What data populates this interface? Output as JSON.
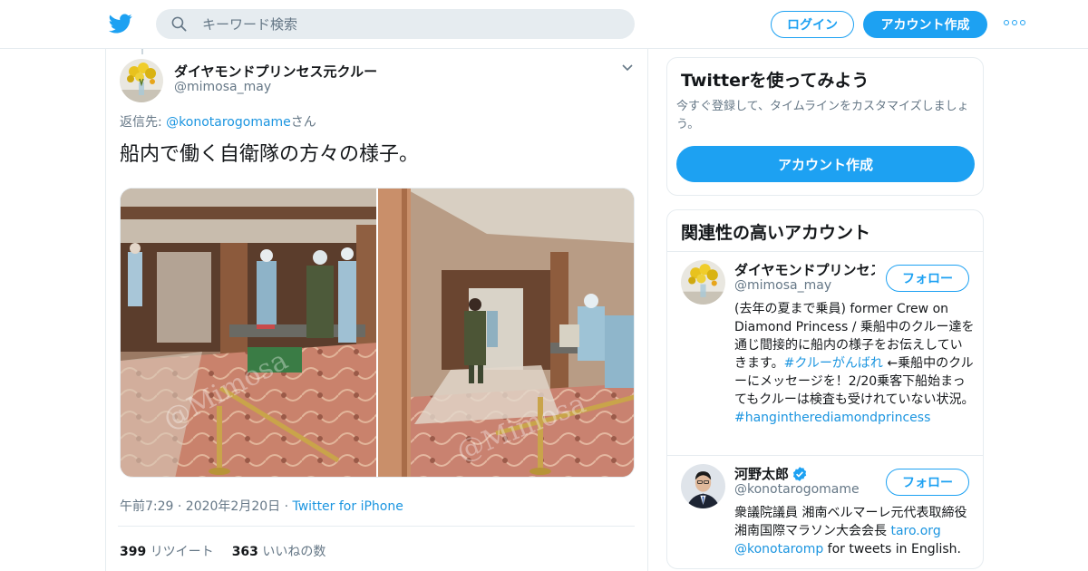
{
  "header": {
    "logo_icon": "twitter-bird-icon",
    "search_placeholder": "キーワード検索",
    "login_label": "ログイン",
    "signup_label": "アカウント作成",
    "more_icon": "more-dots-icon",
    "brand_color": "#1da1f2"
  },
  "tweet": {
    "author_name": "ダイヤモンドプリンセス元クルー",
    "author_handle": "@mimosa_may",
    "replying_prefix": "返信先: ",
    "replying_handle": "@konotarogomame",
    "replying_suffix": "さん",
    "text": "船内で働く自衛隊の方々の様子。",
    "watermark": "@Mimosa",
    "timestamp": "午前7:29 · 2020年2月20日",
    "separator": " · ",
    "source": "Twitter for iPhone",
    "retweet_count": "399",
    "retweet_label": "リツイート",
    "like_count": "363",
    "like_label": "いいねの数"
  },
  "sidebar": {
    "cta": {
      "title": "Twitterを使ってみよう",
      "description": "今すぐ登録して、タイムラインをカスタマイズしましょう。",
      "button_label": "アカウント作成"
    },
    "related": {
      "title": "関連性の高いアカウント",
      "accounts": [
        {
          "name": "ダイヤモンドプリンセス元クルー",
          "handle": "@mimosa_may",
          "follow_label": "フォロー",
          "verified": false,
          "bio_1": "(去年の夏まで乗員) former Crew on Diamond Princess / 乗船中のクルー達を通じ間接的に船内の様子をお伝えしていきます。",
          "bio_tag_1": "#クルーがんばれ",
          "bio_2": " ←乗船中のクルーにメッセージを！2/20乗客下船始まってもクルーは検査も受けれていない状況。",
          "bio_tag_2": "#hangintherediamondprincess"
        },
        {
          "name": "河野太郎",
          "handle": "@konotarogomame",
          "follow_label": "フォロー",
          "verified": true,
          "bio_1": "衆議院議員 湘南ベルマーレ元代表取締役 湘南国際マラソン大会会長 ",
          "bio_link": "taro.org",
          "bio_mention": "@konotaromp",
          "bio_2": " for tweets in English."
        }
      ]
    }
  }
}
